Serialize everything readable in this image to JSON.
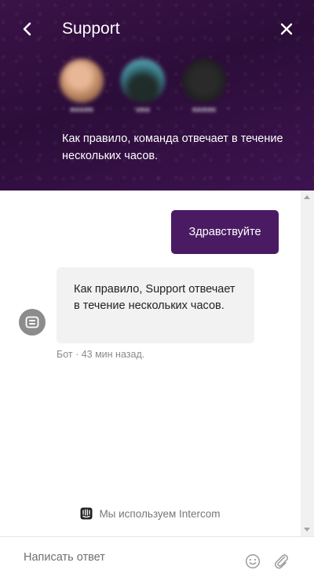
{
  "header": {
    "title": "Support",
    "back_icon": "chevron-left-icon",
    "close_icon": "close-icon",
    "subtitle": "Как правило, команда отвечает в течение нескольких часов.",
    "colors": {
      "background": "#2c0d39",
      "text": "#ffffff"
    },
    "team": [
      {
        "avatar": "avatar-1"
      },
      {
        "avatar": "avatar-2"
      },
      {
        "avatar": "avatar-3"
      }
    ]
  },
  "conversation": {
    "user_message": "Здравствуйте",
    "bot_message": "Как правило, Support отвечает в течение нескольких часов.",
    "bot_meta": "Бот · 43 мин назад.",
    "bot_avatar_icon": "bot-icon",
    "colors": {
      "user_bubble": "#4a1b63",
      "bot_bubble": "#f2f2f2"
    }
  },
  "footer": {
    "powered_by": "Мы используем Intercom",
    "intercom_icon": "intercom-icon"
  },
  "composer": {
    "placeholder": "Написать ответ",
    "emoji_icon": "emoji-icon",
    "attach_icon": "paperclip-icon"
  }
}
